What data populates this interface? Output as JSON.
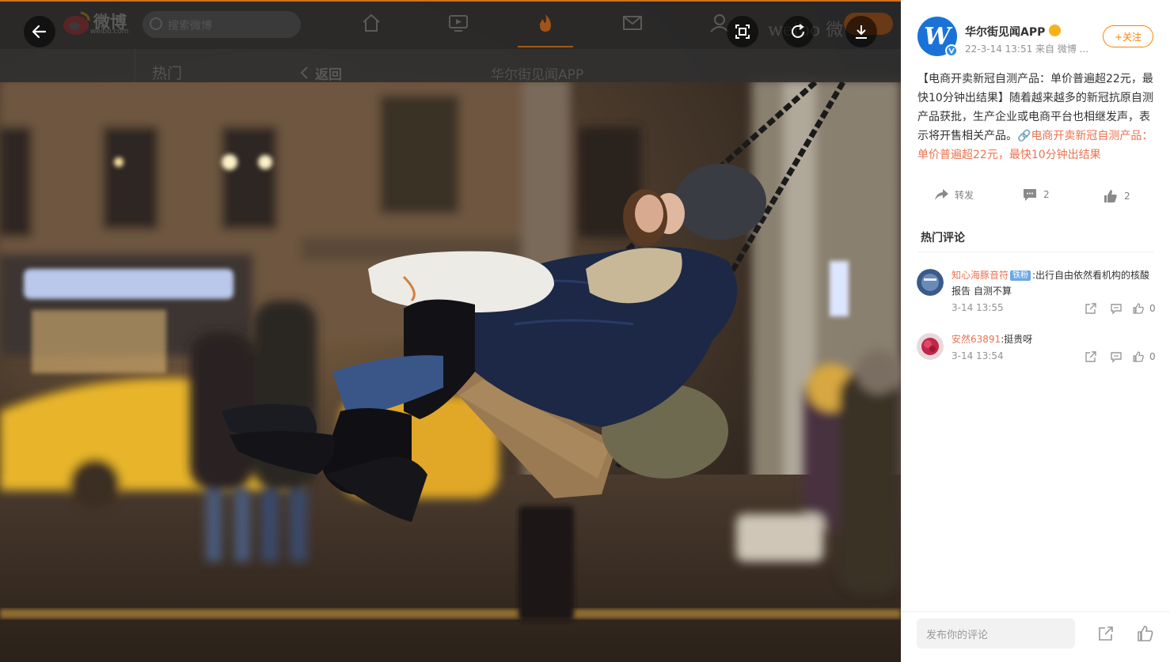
{
  "background_page": {
    "logo_text": "微博",
    "logo_sub": "weibo.com",
    "search_placeholder": "搜索微博",
    "sub_hot": "热门",
    "sub_back": "返回",
    "sub_title": "华尔街见闻APP",
    "right_partial": "weibo 微"
  },
  "viewer": {
    "controls": [
      "back-arrow-icon",
      "fullscreen-icon",
      "rotate-icon",
      "download-icon"
    ],
    "photo_description_colors": {
      "accent": "#d07020"
    }
  },
  "post": {
    "user_name": "华尔街见闻APP",
    "meta": "22-3-14 13:51  来自 微博 ...",
    "follow_label": "+关注",
    "text_main": "【电商开卖新冠自测产品：单价普遍超22元，最快10分钟出结果】随着越来越多的新冠抗原自测产品获批，生产企业或电商平台也相继发声，表示将开售相关产品。",
    "link_icon": "🔗",
    "link_text": "电商开卖新冠自测产品：单价普遍超22元，最快10分钟出结果",
    "repost_label": "转发",
    "comment_count": "2",
    "like_count": "2"
  },
  "hot_comments": {
    "title": "热门评论",
    "items": [
      {
        "name": "知心海豚音符",
        "badge": "铁粉",
        "text": ":出行自由依然看机构的核酸报告 自测不算",
        "time": "3-14 13:55",
        "likes": "0"
      },
      {
        "name": "安然63891",
        "badge": "",
        "text": ":挺贵呀",
        "time": "3-14 13:54",
        "likes": "0"
      }
    ]
  },
  "bottom": {
    "input_placeholder": "发布你的评论"
  },
  "colors": {
    "brand_orange": "#ff8200",
    "link": "#eb7350",
    "verified_blue": "#2f8ce8"
  }
}
